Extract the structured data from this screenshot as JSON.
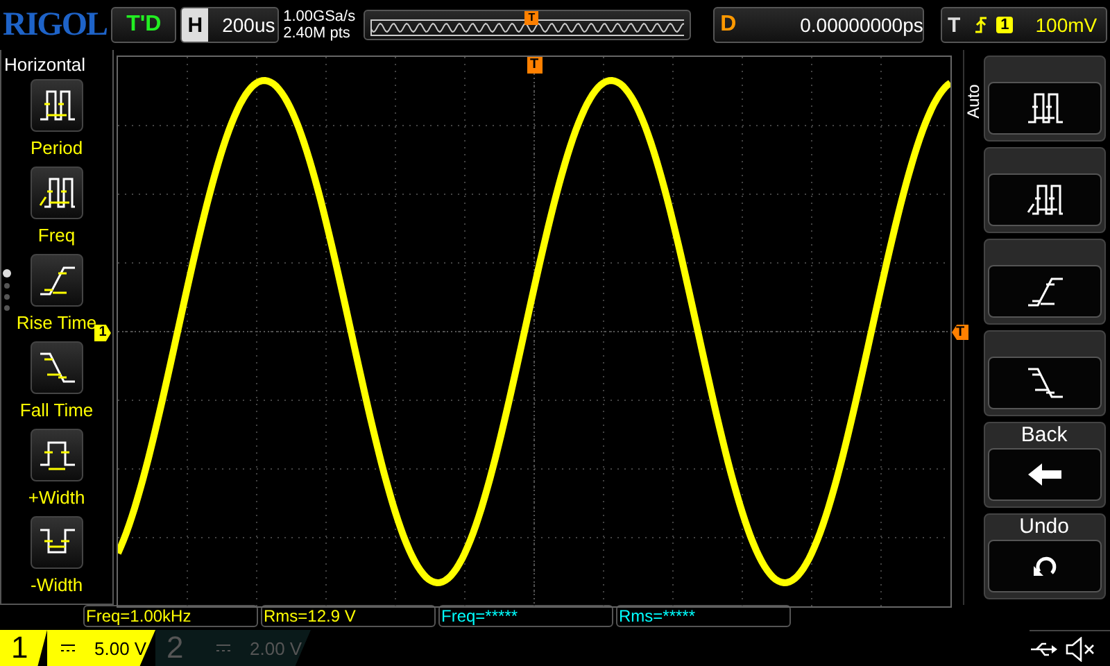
{
  "top_bar": {
    "logo": "RIGOL",
    "run_status": "T'D",
    "timebase": {
      "label": "H",
      "value": "200us"
    },
    "sample_rate": "1.00GSa/s",
    "memory_depth": "2.40M pts",
    "trigger_marker": "T",
    "delay": {
      "label": "D",
      "value": "0.00000000ps"
    },
    "trigger": {
      "label": "T",
      "source": "1",
      "level": "100mV"
    }
  },
  "left_menu": {
    "title": "Horizontal",
    "items": [
      {
        "kind": "period",
        "label": "Period"
      },
      {
        "kind": "freq",
        "label": "Freq"
      },
      {
        "kind": "rise",
        "label": "Rise Time"
      },
      {
        "kind": "fall",
        "label": "Fall Time"
      },
      {
        "kind": "pwidth",
        "label": "+Width"
      },
      {
        "kind": "nwidth",
        "label": "-Width"
      }
    ],
    "page_dots": [
      {
        "selected": true
      },
      {
        "selected": false
      },
      {
        "selected": false
      },
      {
        "selected": false
      }
    ]
  },
  "screen": {
    "trigger_marker": "T",
    "channel_marker": "1",
    "trigger_level_marker": "T"
  },
  "right_menu": {
    "tab": "Auto",
    "buttons": [
      {
        "kind": "period"
      },
      {
        "kind": "freq"
      },
      {
        "kind": "rise"
      },
      {
        "kind": "fall"
      },
      {
        "kind": "back",
        "label": "Back"
      },
      {
        "kind": "undo",
        "label": "Undo"
      }
    ]
  },
  "measurements": [
    {
      "text": "Freq=1.00kHz",
      "color": "#ffff00"
    },
    {
      "text": "Rms=12.9 V",
      "color": "#ffff00"
    },
    {
      "text": "Freq=*****",
      "color": "#00ffff"
    },
    {
      "text": "Rms=*****",
      "color": "#00ffff"
    }
  ],
  "channels": [
    {
      "number": "1",
      "scale": "5.00 V",
      "selected": true
    },
    {
      "number": "2",
      "scale": "2.00 V",
      "selected": false
    }
  ]
}
